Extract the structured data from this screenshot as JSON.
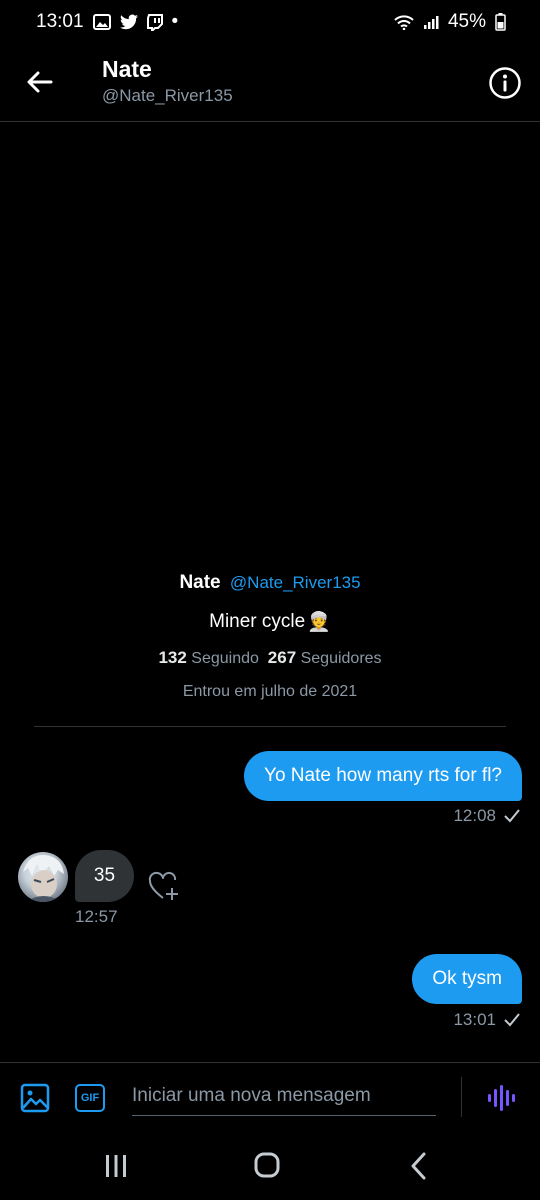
{
  "status_bar": {
    "time": "13:01",
    "dot": "•",
    "battery": "45%"
  },
  "header": {
    "title": "Nate",
    "handle": "@Nate_River135"
  },
  "profile": {
    "name": "Nate",
    "handle": "@Nate_River135",
    "bio": "Miner cycle",
    "bio_emoji": "👳",
    "following_count": "132",
    "following_label": "Seguindo",
    "followers_count": "267",
    "followers_label": "Seguidores",
    "joined": "Entrou em julho de 2021"
  },
  "messages": [
    {
      "direction": "out",
      "text": "Yo Nate how many rts for fl?",
      "time": "12:08"
    },
    {
      "direction": "in",
      "text": "35",
      "time": "12:57"
    },
    {
      "direction": "out",
      "text": "Ok tysm",
      "time": "13:01"
    }
  ],
  "composer": {
    "placeholder": "Iniciar uma nova mensagem",
    "gif_label": "GIF"
  },
  "colors": {
    "accent": "#1d9bf0",
    "background": "#000000",
    "voice": "#7856ff"
  }
}
